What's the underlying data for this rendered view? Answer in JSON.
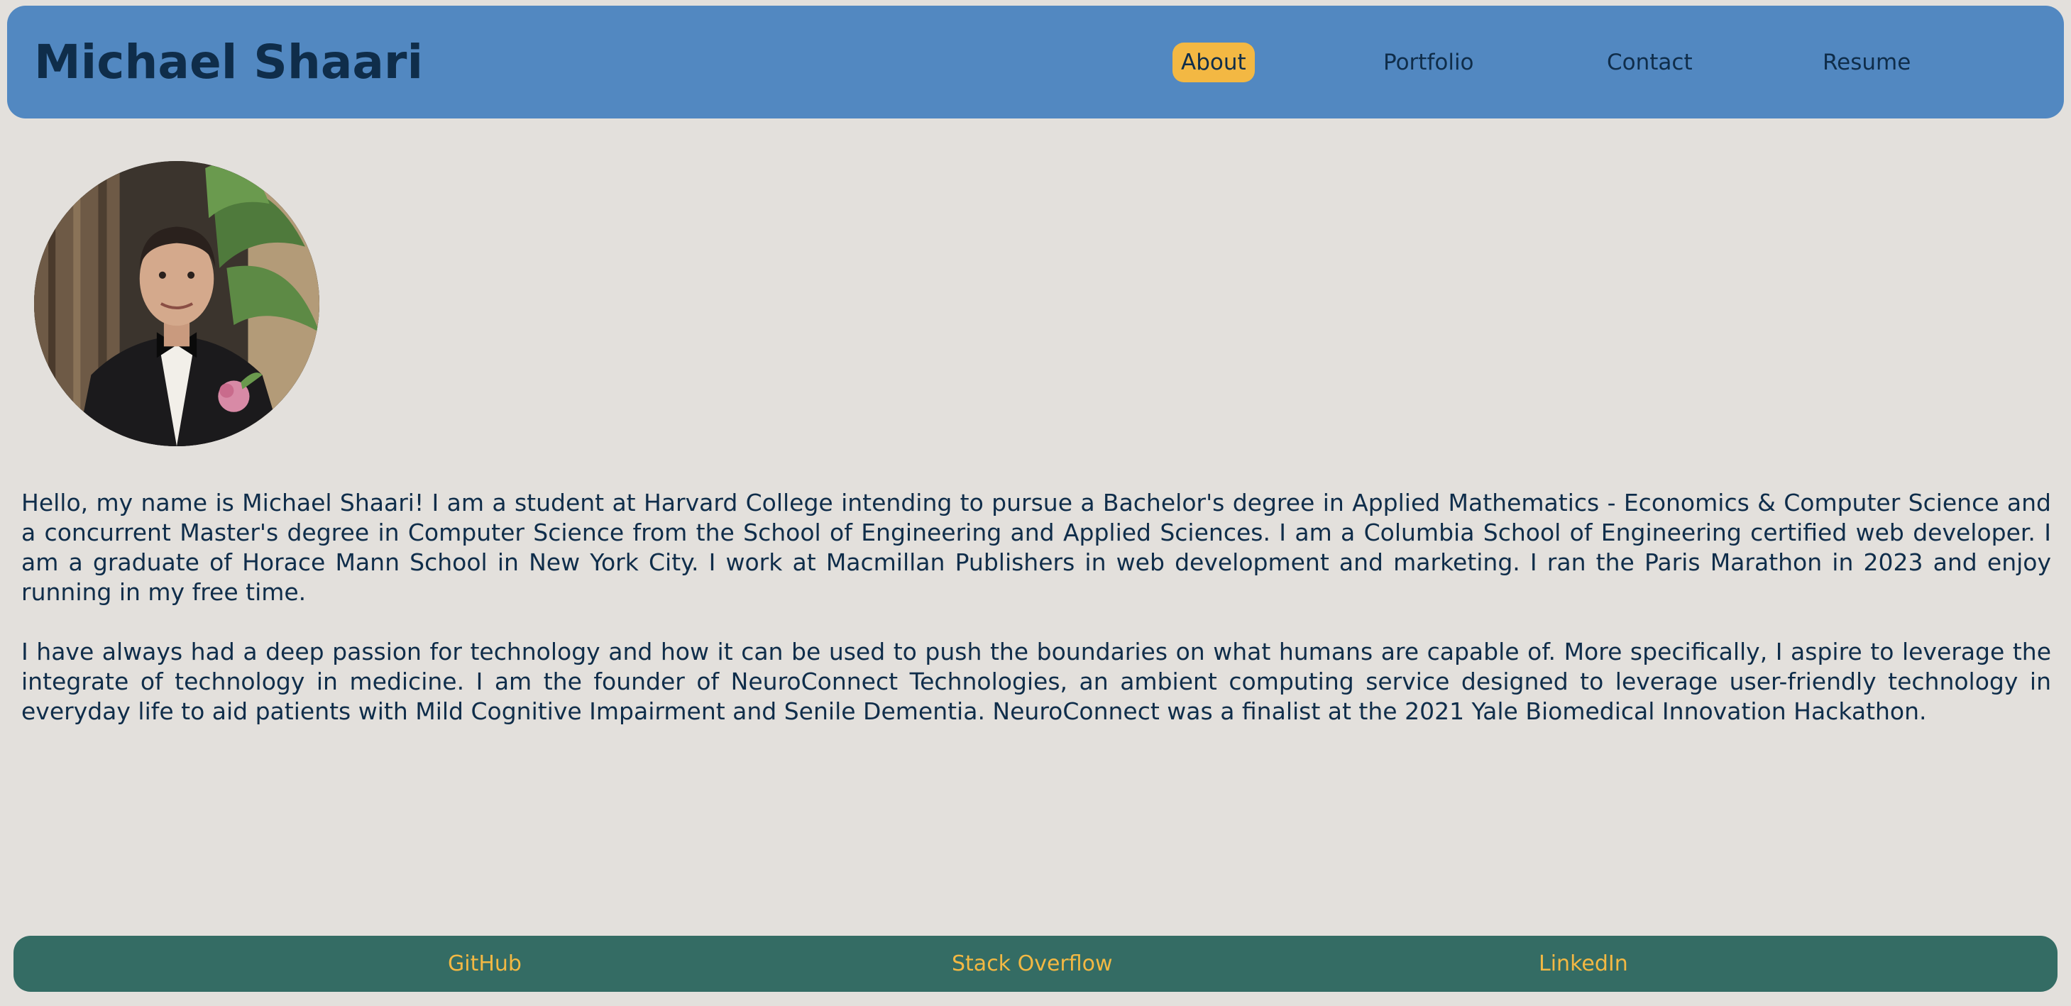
{
  "header": {
    "title": "Michael Shaari",
    "nav": [
      {
        "label": "About",
        "active": true
      },
      {
        "label": "Portfolio",
        "active": false
      },
      {
        "label": "Contact",
        "active": false
      },
      {
        "label": "Resume",
        "active": false
      }
    ]
  },
  "about": {
    "paragraphs": [
      "Hello, my name is Michael Shaari! I am a student at Harvard College intending to pursue a Bachelor's degree in Applied Mathematics - Economics & Computer Science and a concurrent Master's degree in Computer Science from the School of Engineering and Applied Sciences. I am a Columbia School of Engineering certified web developer. I am a graduate of Horace Mann School in New York City. I work at Macmillan Publishers in web development and marketing. I ran the Paris Marathon in 2023 and enjoy running in my free time.",
      "I have always had a deep passion for technology and how it can be used to push the boundaries on what humans are capable of. More specifically, I aspire to leverage the integrate of technology in medicine. I am the founder of NeuroConnect Technologies, an ambient computing service designed to leverage user-friendly technology in everyday life to aid patients with Mild Cognitive Impairment and Senile Dementia. NeuroConnect was a finalist at the 2021 Yale Biomedical Innovation Hackathon."
    ]
  },
  "footer": {
    "links": [
      {
        "label": "GitHub"
      },
      {
        "label": "Stack Overflow"
      },
      {
        "label": "LinkedIn"
      }
    ]
  },
  "colors": {
    "page_background": "#e3e0dc",
    "header_background": "#5288c1",
    "footer_background": "#346c64",
    "accent": "#f3b843",
    "text": "#0f2d4a"
  }
}
